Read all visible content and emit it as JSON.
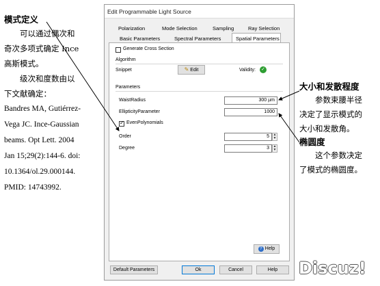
{
  "annotations": {
    "left": {
      "heading": "模式定义",
      "p1_line1": "可以通过偶次和",
      "p1_line2": "奇次多项式确定 Ince",
      "p1_line3": "高斯模式。",
      "p2_line1": "级次和度数由以",
      "p2_line2": "下文献确定：",
      "ref_lines": [
        "Bandres MA, Gutiérrez-",
        "Vega JC. Ince-Gaussian",
        "beams. Opt Lett. 2004",
        "Jan 15;29(2):144-6. doi:",
        "10.1364/ol.29.000144.",
        "PMID: 14743992."
      ]
    },
    "right": {
      "heading1": "大小和发散程度",
      "p1_lines": [
        "参数束腰半径",
        "决定了显示模式的",
        "大小和发散角。"
      ],
      "heading2": "椭圆度",
      "p2_lines": [
        "这个参数决定",
        "了模式的椭圆度。"
      ]
    }
  },
  "dialog": {
    "title": "Edit Programmable Light Source",
    "tabs_row1": [
      "Polarization",
      "Mode Selection",
      "Sampling",
      "Ray Selection"
    ],
    "tabs_row2": [
      "Basic Parameters",
      "Spectral Parameters",
      "Spatial Parameters"
    ],
    "active_tab": "Spatial Parameters",
    "generate_cross_section": "Generate Cross Section",
    "algorithm_section": "Algorithm",
    "snippet_label": "Snippet",
    "edit_button": "Edit",
    "validity_label": "Validity:",
    "parameters_section": "Parameters",
    "waist_radius_label": "WaistRadius",
    "waist_radius_value": "300 µm",
    "ellipticity_label": "EllipticityParameter",
    "ellipticity_value": "1000",
    "even_polynomials_label": "EvenPolynomials",
    "even_polynomials_checked": true,
    "order_label": "Order",
    "order_value": "5",
    "degree_label": "Degree",
    "degree_value": "3",
    "help_button": "Help",
    "default_parameters_button": "Default Parameters",
    "ok_button": "Ok",
    "cancel_button": "Cancel",
    "help_bottom_button": "Help"
  },
  "watermark": "Discuz!"
}
